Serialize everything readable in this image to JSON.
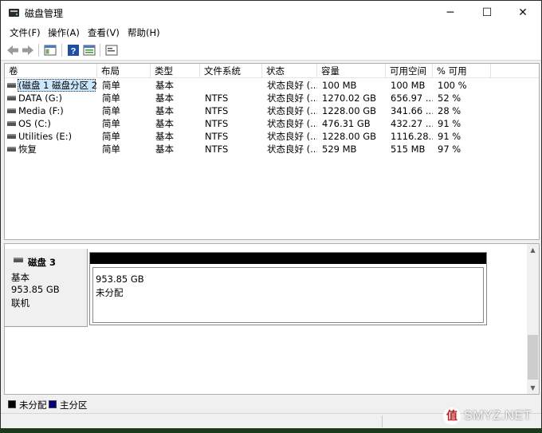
{
  "window": {
    "title": "磁盘管理",
    "controls": {
      "minimize": "─",
      "maximize": "☐",
      "close": "✕"
    }
  },
  "menu": [
    {
      "label": "文件(F)"
    },
    {
      "label": "操作(A)"
    },
    {
      "label": "查看(V)"
    },
    {
      "label": "帮助(H)"
    }
  ],
  "toolbar": {
    "buttons": [
      "back-arrow-icon",
      "forward-arrow-icon",
      "console-tree-icon",
      "help-icon",
      "properties-icon",
      "console-view-icon"
    ]
  },
  "volume_list": {
    "columns": [
      "卷",
      "布局",
      "类型",
      "文件系统",
      "状态",
      "容量",
      "可用空间",
      "% 可用"
    ],
    "rows": [
      {
        "volume": "(磁盘 1 磁盘分区 2)",
        "layout": "简单",
        "type": "基本",
        "fs": "",
        "status": "状态良好 (...",
        "capacity": "100 MB",
        "free": "100 MB",
        "pct": "100 %",
        "selected": true
      },
      {
        "volume": "DATA (G:)",
        "layout": "简单",
        "type": "基本",
        "fs": "NTFS",
        "status": "状态良好 (...",
        "capacity": "1270.02 GB",
        "free": "656.97 ...",
        "pct": "52 %"
      },
      {
        "volume": "Media (F:)",
        "layout": "简单",
        "type": "基本",
        "fs": "NTFS",
        "status": "状态良好 (...",
        "capacity": "1228.00 GB",
        "free": "341.66 ...",
        "pct": "28 %"
      },
      {
        "volume": "OS (C:)",
        "layout": "简单",
        "type": "基本",
        "fs": "NTFS",
        "status": "状态良好 (...",
        "capacity": "476.31 GB",
        "free": "432.27 ...",
        "pct": "91 %"
      },
      {
        "volume": "Utilities (E:)",
        "layout": "简单",
        "type": "基本",
        "fs": "NTFS",
        "status": "状态良好 (...",
        "capacity": "1228.00 GB",
        "free": "1116.28...",
        "pct": "91 %"
      },
      {
        "volume": "恢复",
        "layout": "简单",
        "type": "基本",
        "fs": "NTFS",
        "status": "状态良好 (...",
        "capacity": "529 MB",
        "free": "515 MB",
        "pct": "97 %"
      }
    ]
  },
  "disk": {
    "name": "磁盘 3",
    "type": "基本",
    "size": "953.85 GB",
    "state": "联机",
    "partition": {
      "size": "953.85 GB",
      "state": "未分配",
      "head_color": "#000000"
    }
  },
  "legend": [
    {
      "label": "未分配",
      "color": "#000000"
    },
    {
      "label": "主分区",
      "color": "#000080"
    }
  ],
  "watermark": {
    "logo": "值",
    "text": "SMYZ.NET"
  }
}
